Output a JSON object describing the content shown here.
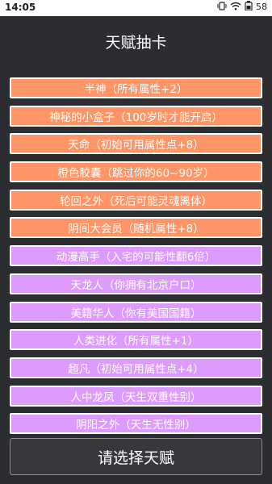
{
  "status": {
    "time": "14:05",
    "battery": "58"
  },
  "title": "天赋抽卡",
  "talents": [
    {
      "label": "半神（所有属性+2）",
      "tier": "orange"
    },
    {
      "label": "神秘的小盒子（100岁时才能开启）",
      "tier": "orange"
    },
    {
      "label": "天命（初始可用属性点+8）",
      "tier": "orange"
    },
    {
      "label": "橙色胶囊（跳过你的60~90岁）",
      "tier": "orange"
    },
    {
      "label": "轮回之外（死后可能灵魂离体）",
      "tier": "orange"
    },
    {
      "label": "阴间大会员（随机属性+8）",
      "tier": "orange"
    },
    {
      "label": "动漫高手（入宅的可能性翻6倍）",
      "tier": "purple"
    },
    {
      "label": "天龙人（你拥有北京户口）",
      "tier": "purple"
    },
    {
      "label": "美籍华人（你有美国国籍）",
      "tier": "purple"
    },
    {
      "label": "人类进化（所有属性+1）",
      "tier": "purple"
    },
    {
      "label": "超凡（初始可用属性点+4）",
      "tier": "purple"
    },
    {
      "label": "人中龙凤（天生双重性别）",
      "tier": "purple"
    },
    {
      "label": "阴阳之外（天生无性别）",
      "tier": "purple"
    }
  ],
  "select_button": "请选择天赋",
  "colors": {
    "orange": "#ff9466",
    "purple": "#dd9bff",
    "background": "#2b2d31"
  }
}
